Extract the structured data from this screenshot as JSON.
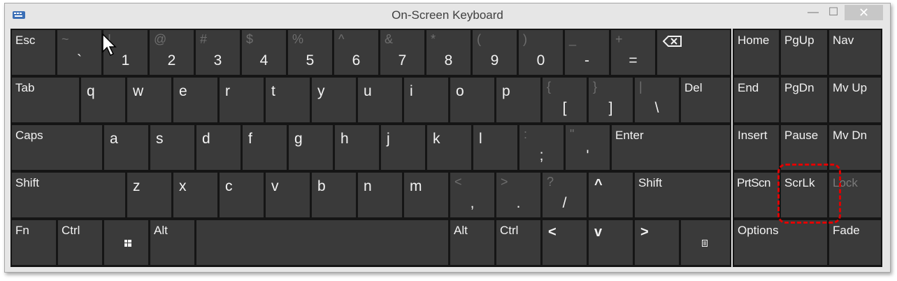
{
  "window": {
    "title": "On-Screen Keyboard",
    "min": "—",
    "max": "☐",
    "close": "✕"
  },
  "keys": {
    "esc": "Esc",
    "tilde": {
      "up": "~",
      "lo": "`"
    },
    "k1": {
      "up": "!",
      "lo": "1"
    },
    "k2": {
      "up": "@",
      "lo": "2"
    },
    "k3": {
      "up": "#",
      "lo": "3"
    },
    "k4": {
      "up": "$",
      "lo": "4"
    },
    "k5": {
      "up": "%",
      "lo": "5"
    },
    "k6": {
      "up": "^",
      "lo": "6"
    },
    "k7": {
      "up": "&",
      "lo": "7"
    },
    "k8": {
      "up": "*",
      "lo": "8"
    },
    "k9": {
      "up": "(",
      "lo": "9"
    },
    "k0": {
      "up": ")",
      "lo": "0"
    },
    "minus": {
      "up": "_",
      "lo": "-"
    },
    "equals": {
      "up": "+",
      "lo": "="
    },
    "tab": "Tab",
    "q": "q",
    "w": "w",
    "e": "e",
    "r": "r",
    "t": "t",
    "y": "y",
    "u": "u",
    "i": "i",
    "o": "o",
    "p": "p",
    "lbracket": {
      "up": "{",
      "lo": "["
    },
    "rbracket": {
      "up": "}",
      "lo": "]"
    },
    "backslash": {
      "up": "|",
      "lo": "\\"
    },
    "del": "Del",
    "caps": "Caps",
    "a": "a",
    "s": "s",
    "d": "d",
    "f": "f",
    "g": "g",
    "h": "h",
    "j": "j",
    "k": "k",
    "l": "l",
    "semicolon": {
      "up": ":",
      "lo": ";"
    },
    "quote": {
      "up": "\"",
      "lo": "'"
    },
    "enter": "Enter",
    "lshift": "Shift",
    "z": "z",
    "x": "x",
    "c": "c",
    "v": "v",
    "b": "b",
    "n": "n",
    "m": "m",
    "comma": {
      "up": "<",
      "lo": ","
    },
    "period": {
      "up": ">",
      "lo": "."
    },
    "slash": {
      "up": "?",
      "lo": "/"
    },
    "up_arrow": "^",
    "rshift": "Shift",
    "fn": "Fn",
    "lctrl": "Ctrl",
    "lalt": "Alt",
    "ralt": "Alt",
    "rctrl": "Ctrl",
    "left_arrow": "<",
    "down_arrow": "v",
    "right_arrow": ">",
    "home": "Home",
    "pgup": "PgUp",
    "nav": "Nav",
    "end": "End",
    "pgdn": "PgDn",
    "mvup": "Mv Up",
    "insert": "Insert",
    "pause": "Pause",
    "mvdn": "Mv Dn",
    "prtscn": "PrtScn",
    "scrlk": "ScrLk",
    "lock": "Lock",
    "options": "Options",
    "fade": "Fade"
  },
  "colors": {
    "key": "#3a3a3a",
    "panel": "#151515",
    "highlight": "#e10000"
  }
}
